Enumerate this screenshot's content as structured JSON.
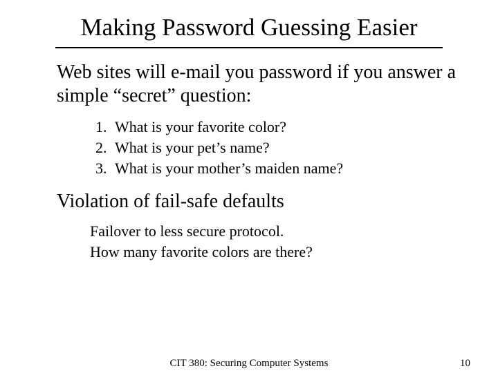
{
  "title": "Making Password Guessing Easier",
  "lead": "Web sites will e-mail you password if you answer a simple “secret” question:",
  "questions": [
    "What is your favorite color?",
    "What is your pet’s name?",
    "What is your mother’s maiden name?"
  ],
  "subhead": "Violation of fail-safe defaults",
  "body": [
    "Failover to less secure protocol.",
    "How many favorite colors are there?"
  ],
  "footer": {
    "center": "CIT 380: Securing Computer Systems",
    "page": "10"
  }
}
